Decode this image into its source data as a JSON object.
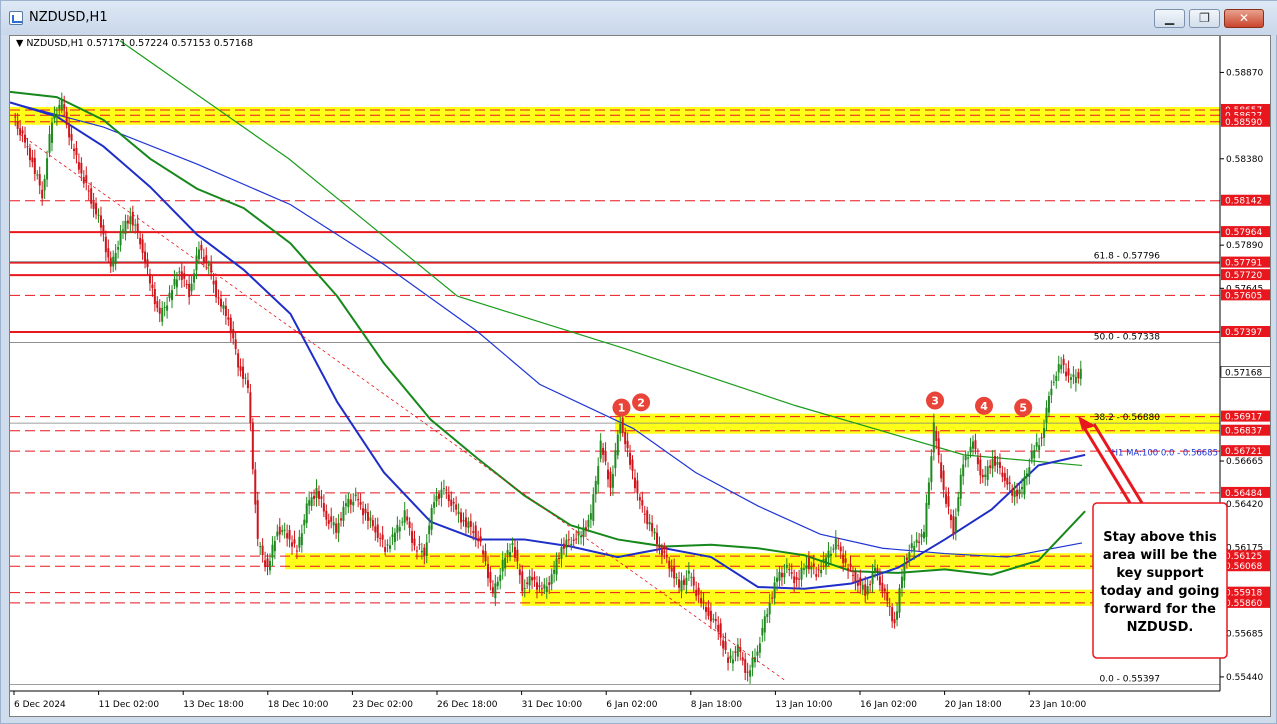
{
  "window": {
    "title": "NZDUSD,H1",
    "buttons": {
      "minimize": "▁",
      "restore": "❐",
      "close": "✕"
    }
  },
  "header": {
    "symbol": "NZDUSD,H1",
    "ohlc": "0.57171 0.57224 0.57153 0.57168"
  },
  "chart_data": {
    "type": "candlestick",
    "symbol": "NZDUSD",
    "timeframe": "H1",
    "ylim": [
      0.5536,
      0.5902
    ],
    "y_ticks": [
      "0.58870",
      "0.58380",
      "0.57890",
      "0.57645",
      "0.56665",
      "0.56420",
      "0.56175",
      "0.55685",
      "0.55440"
    ],
    "x_ticks": [
      "6 Dec 2024",
      "11 Dec 02:00",
      "13 Dec 18:00",
      "18 Dec 10:00",
      "23 Dec 02:00",
      "26 Dec 18:00",
      "31 Dec 10:00",
      "6 Jan 02:00",
      "8 Jan 18:00",
      "13 Jan 10:00",
      "16 Jan 02:00",
      "20 Jan 18:00",
      "23 Jan 10:00"
    ],
    "current_price": "0.57168",
    "price_path": [
      [
        0,
        0.5862
      ],
      [
        1,
        0.585
      ],
      [
        2,
        0.5836
      ],
      [
        3,
        0.5818
      ],
      [
        4,
        0.586
      ],
      [
        5,
        0.587
      ],
      [
        6,
        0.5846
      ],
      [
        7,
        0.583
      ],
      [
        8,
        0.5815
      ],
      [
        9,
        0.58
      ],
      [
        10,
        0.5775
      ],
      [
        11,
        0.5795
      ],
      [
        12,
        0.5806
      ],
      [
        13,
        0.5792
      ],
      [
        14,
        0.5768
      ],
      [
        15,
        0.5748
      ],
      [
        16,
        0.576
      ],
      [
        17,
        0.5775
      ],
      [
        18,
        0.5762
      ],
      [
        19,
        0.5787
      ],
      [
        20,
        0.5776
      ],
      [
        21,
        0.5757
      ],
      [
        22,
        0.5748
      ],
      [
        23,
        0.5722
      ],
      [
        24,
        0.5708
      ],
      [
        25,
        0.562
      ],
      [
        26,
        0.5605
      ],
      [
        27,
        0.5628
      ],
      [
        28,
        0.5625
      ],
      [
        29,
        0.5615
      ],
      [
        30,
        0.564
      ],
      [
        31,
        0.565
      ],
      [
        32,
        0.5635
      ],
      [
        33,
        0.5628
      ],
      [
        34,
        0.5642
      ],
      [
        35,
        0.5645
      ],
      [
        36,
        0.5636
      ],
      [
        37,
        0.5628
      ],
      [
        38,
        0.5617
      ],
      [
        39,
        0.5625
      ],
      [
        40,
        0.5636
      ],
      [
        41,
        0.5618
      ],
      [
        42,
        0.5615
      ],
      [
        43,
        0.5645
      ],
      [
        44,
        0.565
      ],
      [
        45,
        0.564
      ],
      [
        46,
        0.5632
      ],
      [
        47,
        0.5628
      ],
      [
        48,
        0.5615
      ],
      [
        49,
        0.559
      ],
      [
        50,
        0.5608
      ],
      [
        51,
        0.562
      ],
      [
        52,
        0.5595
      ],
      [
        53,
        0.56
      ],
      [
        54,
        0.5592
      ],
      [
        55,
        0.56
      ],
      [
        56,
        0.5618
      ],
      [
        57,
        0.5622
      ],
      [
        58,
        0.5625
      ],
      [
        59,
        0.5635
      ],
      [
        60,
        0.5676
      ],
      [
        61,
        0.5652
      ],
      [
        62,
        0.569
      ],
      [
        63,
        0.5665
      ],
      [
        64,
        0.5642
      ],
      [
        65,
        0.563
      ],
      [
        66,
        0.5618
      ],
      [
        67,
        0.5608
      ],
      [
        68,
        0.5595
      ],
      [
        69,
        0.5602
      ],
      [
        70,
        0.5589
      ],
      [
        71,
        0.558
      ],
      [
        72,
        0.5572
      ],
      [
        73,
        0.5552
      ],
      [
        74,
        0.556
      ],
      [
        75,
        0.5545
      ],
      [
        76,
        0.556
      ],
      [
        77,
        0.5582
      ],
      [
        78,
        0.56
      ],
      [
        79,
        0.5605
      ],
      [
        80,
        0.5598
      ],
      [
        81,
        0.5609
      ],
      [
        82,
        0.5603
      ],
      [
        83,
        0.5611
      ],
      [
        84,
        0.562
      ],
      [
        85,
        0.5608
      ],
      [
        86,
        0.56
      ],
      [
        87,
        0.5592
      ],
      [
        88,
        0.5605
      ],
      [
        89,
        0.559
      ],
      [
        90,
        0.5574
      ],
      [
        91,
        0.561
      ],
      [
        92,
        0.562
      ],
      [
        93,
        0.5625
      ],
      [
        94,
        0.5686
      ],
      [
        95,
        0.565
      ],
      [
        96,
        0.5627
      ],
      [
        97,
        0.5666
      ],
      [
        98,
        0.5676
      ],
      [
        99,
        0.5655
      ],
      [
        100,
        0.5668
      ],
      [
        101,
        0.566
      ],
      [
        102,
        0.5648
      ],
      [
        103,
        0.565
      ],
      [
        104,
        0.567
      ],
      [
        105,
        0.568
      ],
      [
        106,
        0.571
      ],
      [
        107,
        0.5722
      ],
      [
        108,
        0.5712
      ],
      [
        109,
        0.57168
      ]
    ],
    "series": [
      {
        "name": "",
        "color": "#1a9c1a",
        "values": [
          [
            0,
            0.5905
          ],
          [
            40,
            0.5838
          ],
          [
            80,
            0.576
          ],
          [
            120,
            0.573
          ],
          [
            160,
            0.5698
          ],
          [
            200,
            0.567
          ],
          [
            228,
            0.5664
          ]
        ]
      },
      {
        "name": "",
        "color": "#1e35d6",
        "values": [
          [
            0,
            0.587
          ],
          [
            30,
            0.5856
          ],
          [
            60,
            0.5835
          ],
          [
            90,
            0.5812
          ],
          [
            120,
            0.5778
          ],
          [
            150,
            0.574
          ],
          [
            170,
            0.571
          ],
          [
            200,
            0.5685
          ],
          [
            220,
            0.566
          ],
          [
            240,
            0.5641
          ],
          [
            260,
            0.5625
          ],
          [
            280,
            0.5617
          ],
          [
            300,
            0.5614
          ],
          [
            320,
            0.5612
          ],
          [
            344,
            0.562
          ]
        ]
      },
      {
        "name": "",
        "color": "#17881b",
        "values": [
          [
            0,
            0.5876
          ],
          [
            15,
            0.5873
          ],
          [
            30,
            0.586
          ],
          [
            45,
            0.5838
          ],
          [
            60,
            0.5821
          ],
          [
            75,
            0.581
          ],
          [
            90,
            0.579
          ],
          [
            105,
            0.576
          ],
          [
            120,
            0.5722
          ],
          [
            135,
            0.569
          ],
          [
            150,
            0.5668
          ],
          [
            165,
            0.5647
          ],
          [
            180,
            0.563
          ],
          [
            195,
            0.5622
          ],
          [
            210,
            0.5618
          ],
          [
            225,
            0.5619
          ],
          [
            240,
            0.5617
          ],
          [
            255,
            0.5613
          ],
          [
            270,
            0.5604
          ],
          [
            285,
            0.5603
          ],
          [
            300,
            0.5605
          ],
          [
            315,
            0.5602
          ],
          [
            330,
            0.561
          ],
          [
            345,
            0.5638
          ]
        ]
      },
      {
        "name": "",
        "color": "#1f2ec8",
        "values": [
          [
            0,
            0.587
          ],
          [
            15,
            0.5862
          ],
          [
            30,
            0.5845
          ],
          [
            45,
            0.5822
          ],
          [
            60,
            0.5795
          ],
          [
            75,
            0.5775
          ],
          [
            90,
            0.575
          ],
          [
            105,
            0.57
          ],
          [
            120,
            0.566
          ],
          [
            135,
            0.5632
          ],
          [
            150,
            0.5622
          ],
          [
            165,
            0.5622
          ],
          [
            180,
            0.5618
          ],
          [
            195,
            0.5612
          ],
          [
            210,
            0.5617
          ],
          [
            225,
            0.5612
          ],
          [
            240,
            0.5595
          ],
          [
            255,
            0.5594
          ],
          [
            270,
            0.5597
          ],
          [
            285,
            0.5606
          ],
          [
            300,
            0.5622
          ],
          [
            315,
            0.5639
          ],
          [
            330,
            0.5664
          ],
          [
            345,
            0.567
          ]
        ]
      }
    ],
    "horizontal_levels": [
      {
        "price": "0.58657",
        "value": 0.58657,
        "style": "zone"
      },
      {
        "price": "0.58627",
        "value": 0.58627,
        "style": "dashed"
      },
      {
        "price": "0.58590",
        "value": 0.5859,
        "style": "zone"
      },
      {
        "price": "0.58142",
        "value": 0.58142,
        "style": "dashed"
      },
      {
        "price": "0.57964",
        "value": 0.57964,
        "style": "solid"
      },
      {
        "price": "0.57791",
        "value": 0.57791,
        "style": "solid"
      },
      {
        "price": "0.57720",
        "value": 0.5772,
        "style": "solid"
      },
      {
        "price": "0.57605",
        "value": 0.57605,
        "style": "dashed"
      },
      {
        "price": "0.57397",
        "value": 0.57397,
        "style": "solid"
      },
      {
        "price": "0.56917",
        "value": 0.56917,
        "style": "zone"
      },
      {
        "price": "0.56837",
        "value": 0.56837,
        "style": "zone"
      },
      {
        "price": "0.56721",
        "value": 0.56721,
        "style": "dashed"
      },
      {
        "price": "0.56484",
        "value": 0.56484,
        "style": "dashed"
      },
      {
        "price": "0.56125",
        "value": 0.56125,
        "style": "zone"
      },
      {
        "price": "0.56068",
        "value": 0.56068,
        "style": "zone"
      },
      {
        "price": "0.55918",
        "value": 0.55918,
        "style": "zone"
      },
      {
        "price": "0.55860",
        "value": 0.5586,
        "style": "zone"
      }
    ],
    "fibonacci": [
      {
        "label": "61.8 - 0.57796",
        "value": 0.57796
      },
      {
        "label": "50.0 - 0.57338",
        "value": 0.57338
      },
      {
        "label": "38.2 - 0.56880",
        "value": 0.5688
      },
      {
        "label": "0.0 - 0.55397",
        "value": 0.55397
      }
    ],
    "ma_label": "H1 MA:100 0.0 - 0.56685",
    "markers": [
      {
        "label": "1",
        "x": 62,
        "y": 0.569
      },
      {
        "label": "2",
        "x": 64,
        "y": 0.5693
      },
      {
        "label": "3",
        "x": 94,
        "y": 0.5694
      },
      {
        "label": "4",
        "x": 99,
        "y": 0.5691
      },
      {
        "label": "5",
        "x": 103,
        "y": 0.569
      }
    ],
    "annotation": {
      "text_lines": [
        "Stay above this",
        "area will be the",
        "key support",
        "today and going",
        "forward for the",
        "NZDUSD."
      ]
    }
  }
}
